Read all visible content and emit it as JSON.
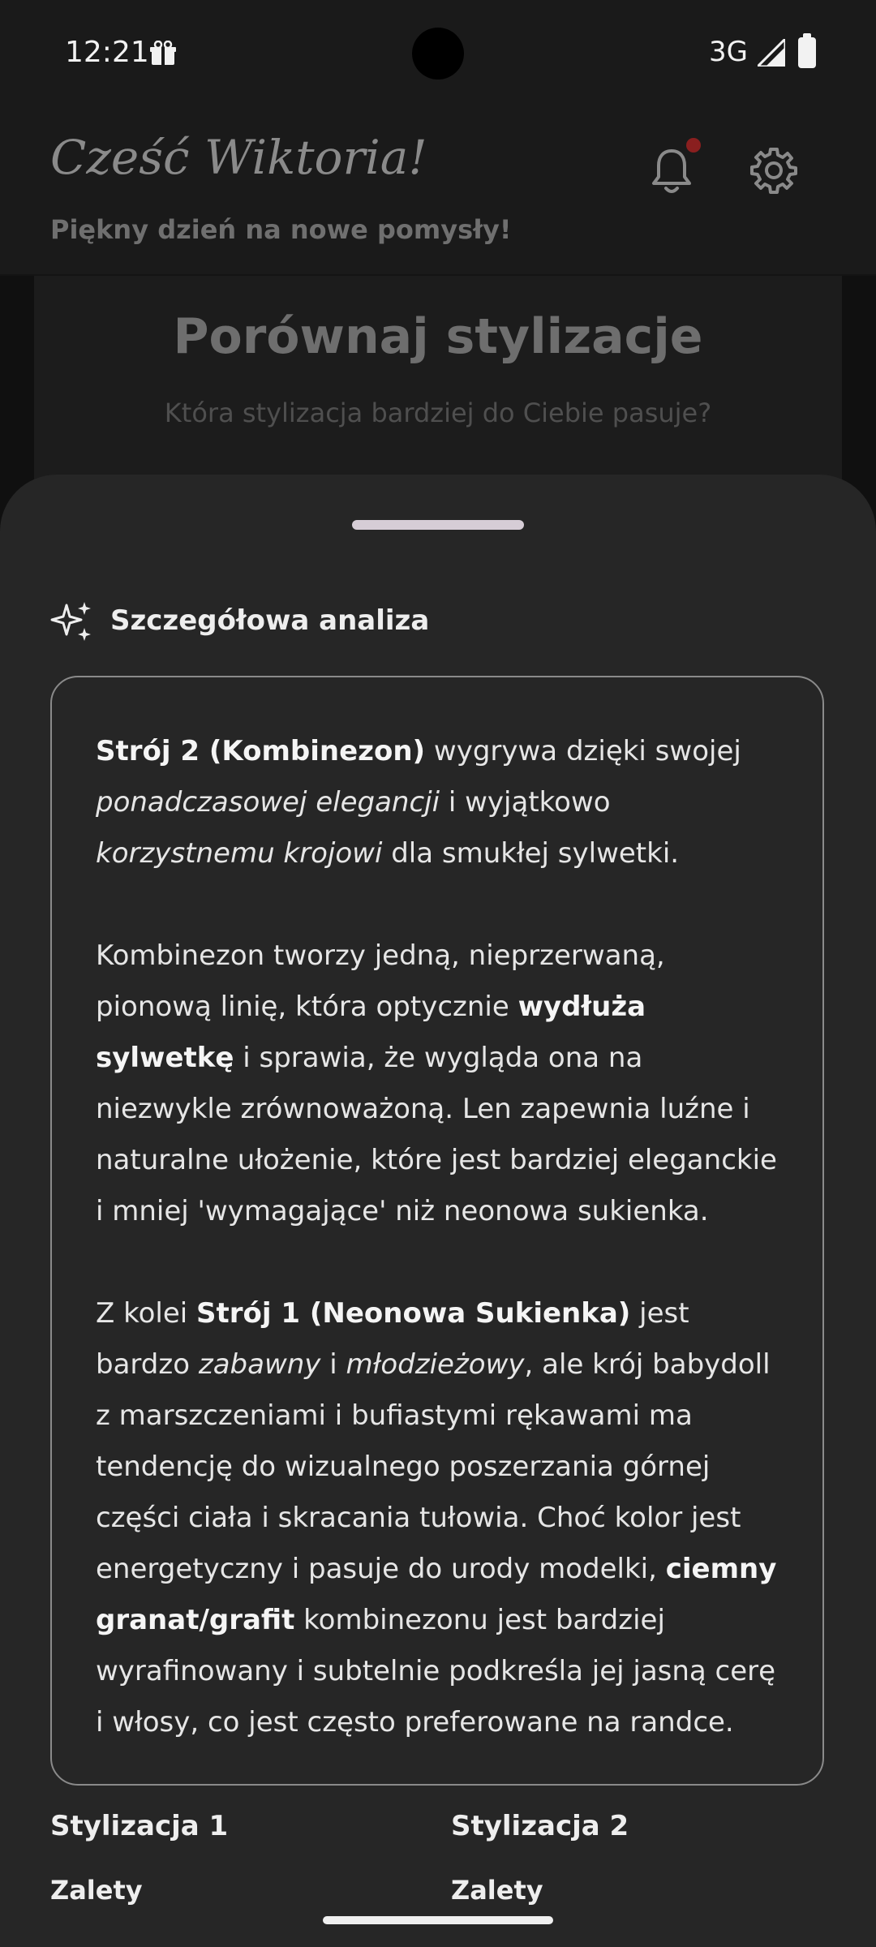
{
  "status_bar": {
    "time": "12:21",
    "network": "3G",
    "notification_icon": "gift-icon",
    "signal_icon": "signal-icon",
    "battery_icon": "battery-icon"
  },
  "header": {
    "greeting": "Cześć Wiktoria!",
    "subtitle": "Piękny dzień na nowe pomysły!",
    "bell_icon": "bell-icon",
    "settings_icon": "gear-icon",
    "notification_dot_color": "#8a1f1f"
  },
  "page": {
    "title": "Porównaj stylizacje",
    "subtitle": "Która stylizacja bardziej do Ciebie pasuje?"
  },
  "sheet": {
    "section_title": "Szczegółowa analiza",
    "section_icon": "sparkles-icon",
    "analysis": {
      "p1": {
        "b1": "Strój 2 (Kombinezon)",
        "t1": " wygrywa dzięki swojej ",
        "i1": "ponadczasowej elegancji",
        "t2": " i wyjątkowo ",
        "i2": "korzystnemu krojowi",
        "t3": " dla smukłej sylwetki."
      },
      "p2": {
        "t1": "Kombinezon tworzy jedną, nieprzerwaną, pionową linię, która optycznie ",
        "b1": "wydłuża sylwetkę",
        "t2": " i sprawia, że wygląda ona na niezwykle zrównoważoną. Len zapewnia luźne i naturalne ułożenie, które jest bardziej eleganckie i mniej 'wymagające' niż neonowa sukienka."
      },
      "p3": {
        "t1": "Z kolei ",
        "b1": "Strój 1 (Neonowa Sukienka)",
        "t2": " jest bardzo ",
        "i1": "zabawny",
        "t3": " i ",
        "i2": "młodzieżowy",
        "t4": ", ale krój babydoll z marszczeniami i bufiastymi rękawami ma tendencję do wizualnego poszerzania górnej części ciała i skracania tułowia. Choć kolor jest energetyczny i pasuje do urody modelki, ",
        "b2": "ciemny granat/grafit",
        "t5": " kombinezonu jest bardziej wyrafinowany i subtelnie podkreśla jej jasną cerę i włosy, co jest często preferowane na randce."
      }
    },
    "columns": [
      {
        "title": "Stylizacja 1",
        "pros_label": "Zalety"
      },
      {
        "title": "Stylizacja 2",
        "pros_label": "Zalety"
      }
    ]
  }
}
